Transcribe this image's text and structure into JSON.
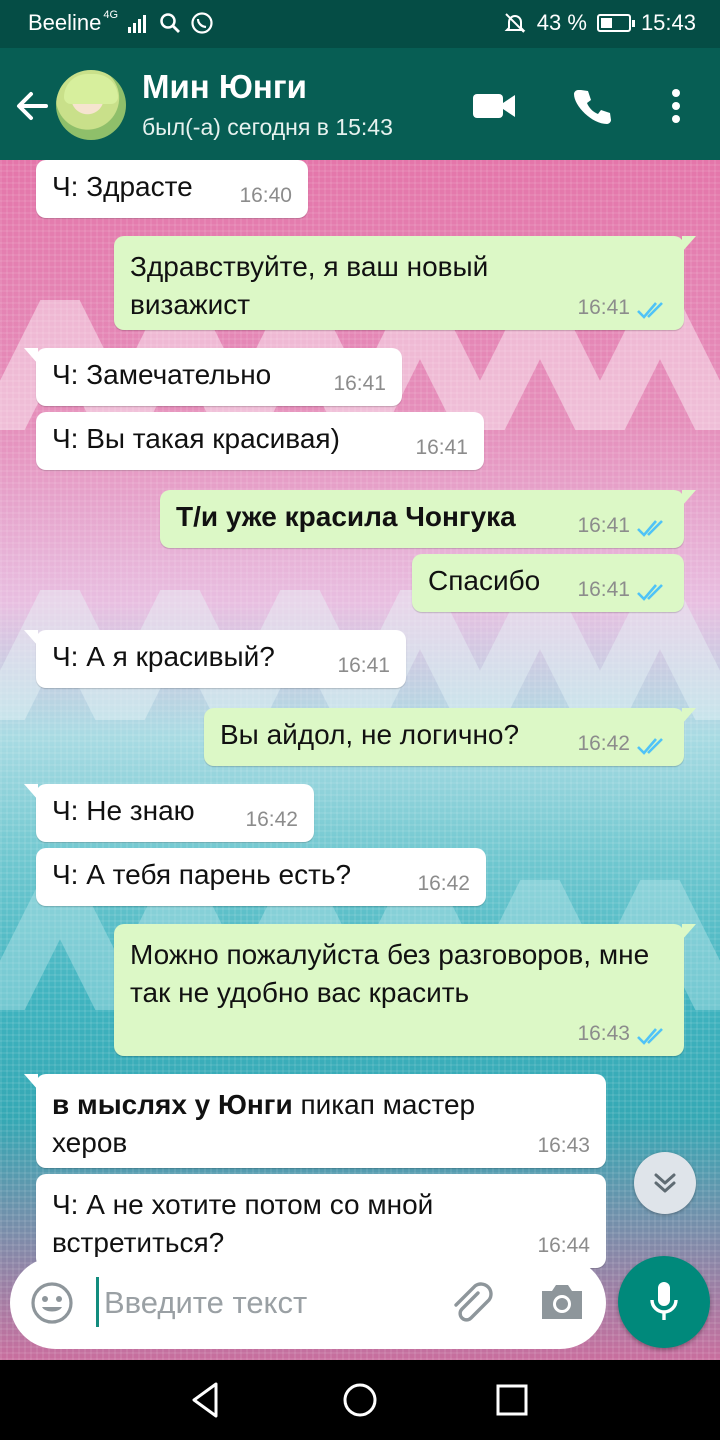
{
  "status_bar": {
    "carrier": "Beeline",
    "network": "4G",
    "battery": "43 %",
    "battery_level": 0.43,
    "time": "15:43"
  },
  "header": {
    "contact_name": "Мин Юнги",
    "last_seen": "был(-а) сегодня в 15:43",
    "icons": [
      "back-arrow-icon",
      "video-call-icon",
      "phone-icon",
      "more-vert-icon"
    ]
  },
  "messages": [
    {
      "dir": "in",
      "text": "Ч: Здрасте",
      "time": "16:40"
    },
    {
      "dir": "out",
      "text": "Здравствуйте, я ваш новый визажист",
      "time": "16:41",
      "read": true
    },
    {
      "dir": "in",
      "text": "Ч: Замечательно",
      "time": "16:41"
    },
    {
      "dir": "in",
      "text": "Ч: Вы такая красивая)",
      "time": "16:41"
    },
    {
      "dir": "out",
      "text": "Т/и уже красила Чонгука",
      "time": "16:41",
      "read": true,
      "bold": true
    },
    {
      "dir": "out",
      "text": "Спасибо",
      "time": "16:41",
      "read": true
    },
    {
      "dir": "in",
      "text": "Ч: А я красивый?",
      "time": "16:41"
    },
    {
      "dir": "out",
      "text": "Вы айдол, не логично?",
      "time": "16:42",
      "read": true
    },
    {
      "dir": "in",
      "text": "Ч: Не знаю",
      "time": "16:42"
    },
    {
      "dir": "in",
      "text": "Ч: А тебя парень есть?",
      "time": "16:42"
    },
    {
      "dir": "out",
      "text": "Можно пожалуйста без разговоров, мне так не удобно вас красить",
      "time": "16:43",
      "read": true
    },
    {
      "dir": "in",
      "bold_prefix": "в мыслях у Юнги",
      "text": " пикап мастер херов",
      "time": "16:43"
    },
    {
      "dir": "in",
      "text": "Ч: А не хотите потом со мной встретиться?",
      "time": "16:44"
    }
  ],
  "composer": {
    "placeholder": "Введите текст",
    "icons": [
      "emoji-icon",
      "attach-icon",
      "camera-icon",
      "mic-icon"
    ]
  },
  "colors": {
    "appbar": "#075e54",
    "statusbar": "#054d45",
    "outgoing_bubble": "#dcf8c6",
    "incoming_bubble": "#ffffff",
    "read_ticks": "#4fc3f7",
    "mic_button": "#00897b"
  }
}
